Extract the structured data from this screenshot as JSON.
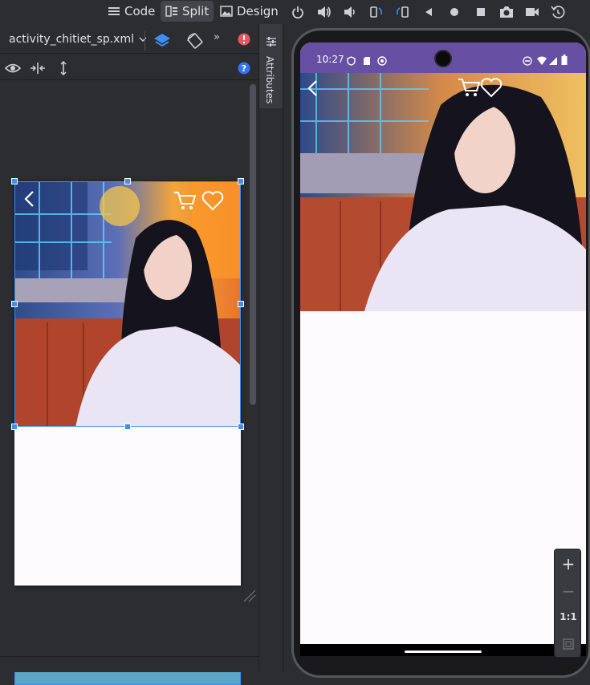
{
  "view_modes": [
    {
      "label": "Code"
    },
    {
      "label": "Split"
    },
    {
      "label": "Design"
    }
  ],
  "editor": {
    "file_name": "activity_chitiet_sp.xml",
    "attributes_label": "Attributes"
  },
  "emulator": {
    "status_time": "10:27",
    "zoom": {
      "plus": "+",
      "minus": "−",
      "reset": "1:1"
    }
  },
  "colors": {
    "status_bar": "#6750a4",
    "selection": "#3d8ff5",
    "error_badge": "#e55765",
    "help_badge": "#3574f0"
  },
  "icons": {
    "back": "chevron-left",
    "cart": "shopping-cart",
    "favorite": "heart"
  }
}
